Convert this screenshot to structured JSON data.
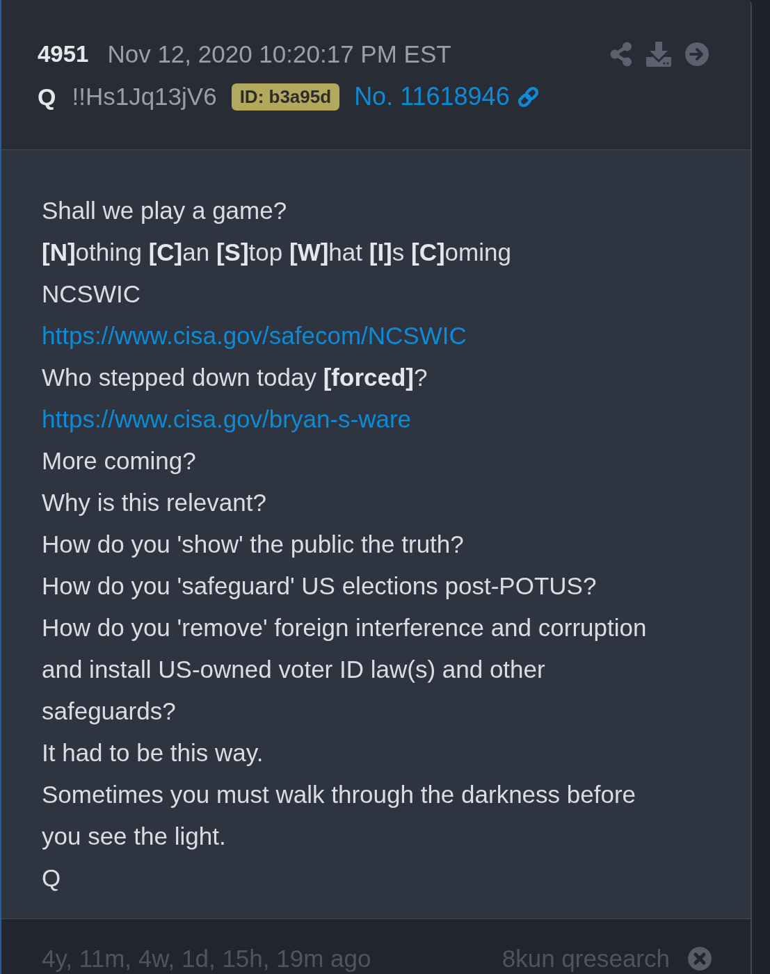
{
  "post": {
    "header": {
      "number": "4951",
      "date": "Nov 12, 2020 10:20:17 PM EST",
      "author": "Q",
      "tripcode": "!!Hs1Jq13jV6",
      "id_badge": {
        "label": "ID: b3a95d",
        "color": "#b3a95d"
      },
      "post_link": "No. 11618946"
    },
    "body": [
      {
        "kind": "text",
        "text": "Shall we play a game?"
      },
      {
        "kind": "text",
        "text": "**[N]**othing **[C]**an **[S]**top **[W]**hat **[I]**s **[C]**oming"
      },
      {
        "kind": "text",
        "text": "NCSWIC"
      },
      {
        "kind": "link",
        "text": "https://www.cisa.gov/safecom/NCSWIC"
      },
      {
        "kind": "text",
        "text": "Who stepped down today **[forced]**?"
      },
      {
        "kind": "link",
        "text": "https://www.cisa.gov/bryan-s-ware"
      },
      {
        "kind": "text",
        "text": "More coming?"
      },
      {
        "kind": "text",
        "text": "Why is this relevant?"
      },
      {
        "kind": "text",
        "text": "How do you 'show' the public the truth?"
      },
      {
        "kind": "text",
        "text": "How do you 'safeguard' US elections post-POTUS?"
      },
      {
        "kind": "text",
        "text": "How do you 'remove' foreign interference and corruption and install US-owned voter ID law(s) and other safeguards?"
      },
      {
        "kind": "text",
        "text": "It had to be this way."
      },
      {
        "kind": "text",
        "text": "Sometimes you must walk through the darkness before you see the light."
      },
      {
        "kind": "text",
        "text": "Q"
      }
    ],
    "footer": {
      "age": "4y, 11m, 4w, 1d, 15h, 19m ago",
      "source": "8kun qresearch"
    }
  }
}
